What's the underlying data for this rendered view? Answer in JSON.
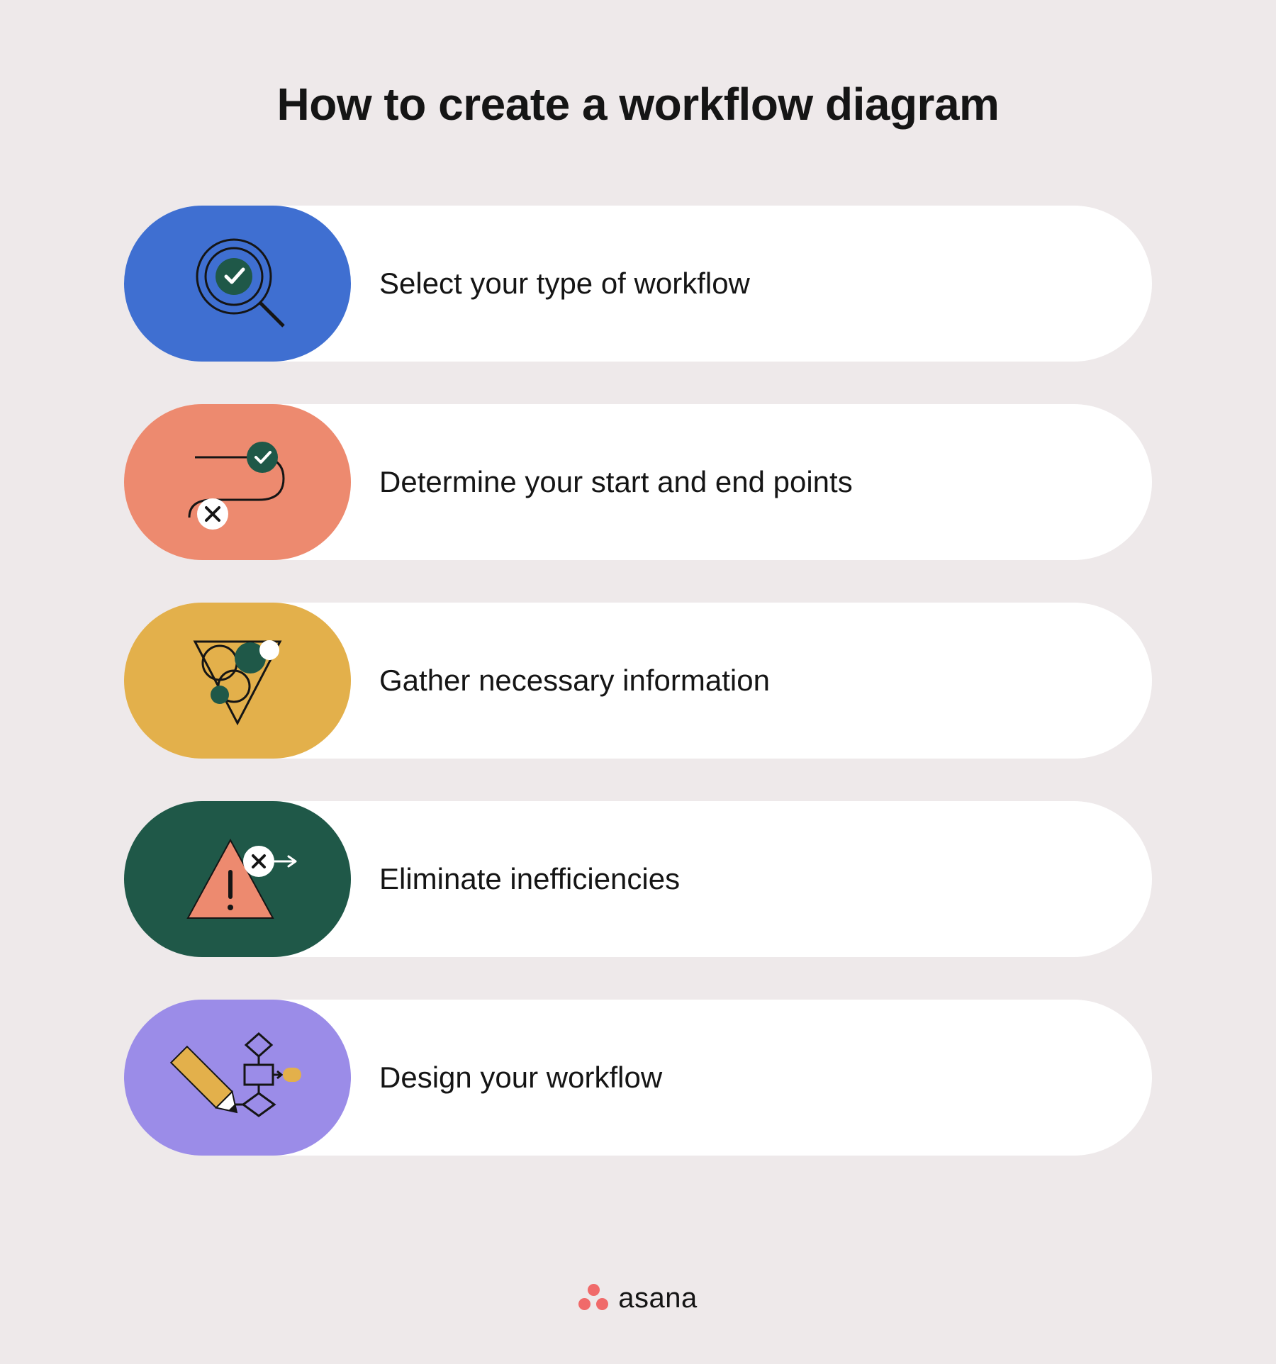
{
  "title": "How to create a workflow diagram",
  "steps": [
    {
      "label": "Select your type of workflow",
      "color": "#3f6fd1",
      "colorClass": "c-blue",
      "icon": "magnifier-check-icon"
    },
    {
      "label": "Determine your start and end points",
      "color": "#ed8a6f",
      "colorClass": "c-coral",
      "icon": "path-start-end-icon"
    },
    {
      "label": "Gather necessary information",
      "color": "#e3b04b",
      "colorClass": "c-gold",
      "icon": "funnel-icon"
    },
    {
      "label": "Eliminate inefficiencies",
      "color": "#1f5848",
      "colorClass": "c-teal",
      "icon": "warning-remove-icon"
    },
    {
      "label": "Design your workflow",
      "color": "#9b8ce8",
      "colorClass": "c-lilac",
      "icon": "pencil-flowchart-icon"
    }
  ],
  "footer": {
    "brand": "asana"
  }
}
